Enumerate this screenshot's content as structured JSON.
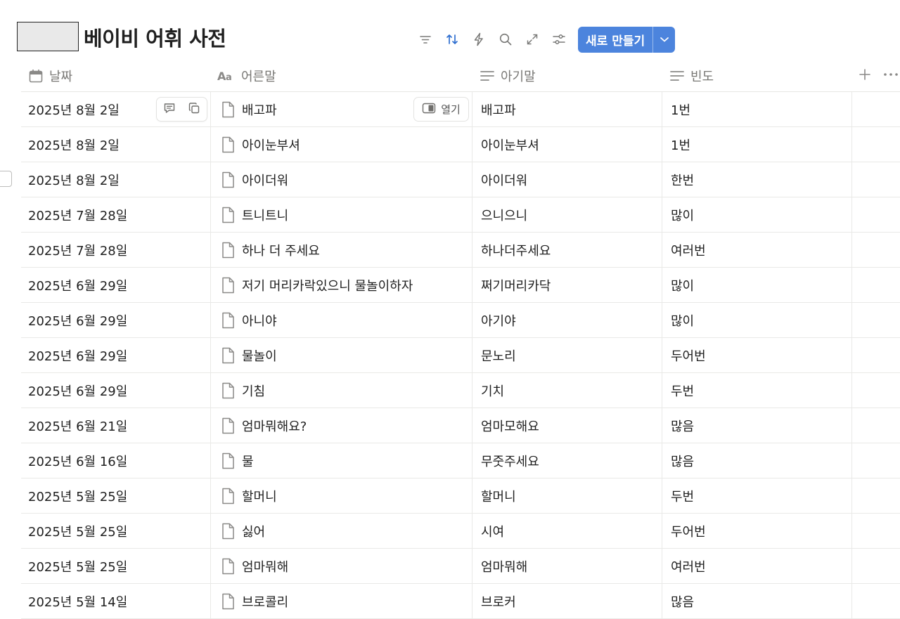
{
  "database": {
    "title": "베이비 어휘 사전"
  },
  "toolbar": {
    "icons": [
      "filter-icon",
      "sort-icon",
      "automation-icon",
      "search-icon",
      "expand-icon",
      "settings-icon"
    ],
    "new_button_label": "새로 만들기",
    "accent_color": "#4c84dd"
  },
  "columns": {
    "date": "날짜",
    "adult": "어른말",
    "baby": "아기말",
    "frequency": "빈도"
  },
  "row_actions": {
    "open_label": "열기"
  },
  "rows": [
    {
      "date": "2025년 8월 2일",
      "adult": "배고파",
      "baby": "배고파",
      "frequency": "1번"
    },
    {
      "date": "2025년 8월 2일",
      "adult": "아이눈부셔",
      "baby": "아이눈부셔",
      "frequency": "1번"
    },
    {
      "date": "2025년 8월 2일",
      "adult": "아이더워",
      "baby": "아이더워",
      "frequency": "한번"
    },
    {
      "date": "2025년 7월 28일",
      "adult": "트니트니",
      "baby": "으니으니",
      "frequency": "많이"
    },
    {
      "date": "2025년 7월 28일",
      "adult": "하나 더 주세요",
      "baby": "하나더주세요",
      "frequency": "여러번"
    },
    {
      "date": "2025년 6월 29일",
      "adult": "저기 머리카락있으니 물놀이하자",
      "baby": "쩌기머리카닥",
      "frequency": "많이"
    },
    {
      "date": "2025년 6월 29일",
      "adult": "아니야",
      "baby": "아기야",
      "frequency": "많이"
    },
    {
      "date": "2025년 6월 29일",
      "adult": "물놀이",
      "baby": "문노리",
      "frequency": "두어번"
    },
    {
      "date": "2025년 6월 29일",
      "adult": "기침",
      "baby": "기치",
      "frequency": "두번"
    },
    {
      "date": "2025년 6월 21일",
      "adult": "엄마뭐해요?",
      "baby": "엄마모해요",
      "frequency": "많음"
    },
    {
      "date": "2025년 6월 16일",
      "adult": "물",
      "baby": "무줏주세요",
      "frequency": "많음"
    },
    {
      "date": "2025년 5월 25일",
      "adult": "할머니",
      "baby": "할머니",
      "frequency": "두번"
    },
    {
      "date": "2025년 5월 25일",
      "adult": "싫어",
      "baby": "시여",
      "frequency": "두어번"
    },
    {
      "date": "2025년 5월 25일",
      "adult": "엄마뭐해",
      "baby": "엄마뭐해",
      "frequency": "여러번"
    },
    {
      "date": "2025년 5월 14일",
      "adult": "브로콜리",
      "baby": "브로커",
      "frequency": "많음"
    }
  ]
}
